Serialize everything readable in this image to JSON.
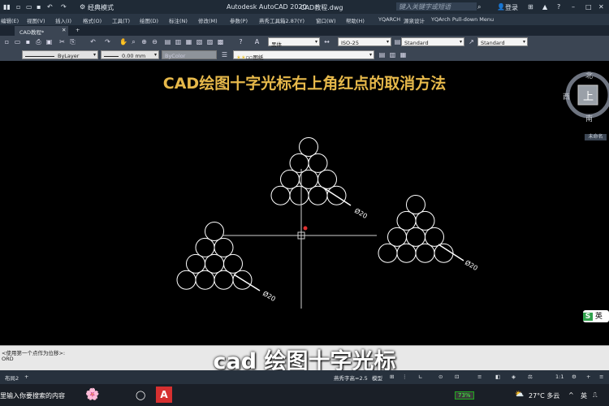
{
  "titlebar": {
    "workspace": "经典模式",
    "app_title": "Autodesk AutoCAD 2020",
    "file_title": "CAD教程.dwg",
    "search_placeholder": "键入关键字或短语",
    "login_label": "登录"
  },
  "menubar": {
    "items": [
      "编辑(E)",
      "视图(V)",
      "插入(I)",
      "格式(O)",
      "工具(T)",
      "绘图(D)",
      "标注(N)",
      "修改(M)",
      "参数(P)",
      "燕秀工具箱2.87(Y)",
      "窗口(W)",
      "帮助(H)",
      "YQARCH",
      "源泉设计",
      "YQArch Pull-down Menu"
    ]
  },
  "tabs": {
    "document": "CAD教程*",
    "add": "+"
  },
  "toolbar1": {
    "font": "黑体",
    "dimstyle": "ISO-25",
    "tablestyle": "Standard",
    "mlstyle": "Standard"
  },
  "toolbar2": {
    "linetype": "ByLayer",
    "lineweight": "0.00 mm",
    "color": "ByColor",
    "layer": "图纸"
  },
  "drawing": {
    "heading": "CAD绘图十字光标右上角红点的取消方法",
    "dim_label_1": "Ø20",
    "dim_label_2": "Ø20",
    "dim_label_3": "Ø20",
    "accent": "#e6b84a"
  },
  "viewcube": {
    "north": "北",
    "south": "南",
    "west": "西",
    "top": "上",
    "nav_label": "未命名"
  },
  "command": {
    "line1": "<使用第一个点作为位移>:",
    "line2": "ORD"
  },
  "subtitle": "cad 绘图十字光标",
  "statusbar": {
    "layout_tab": "布局2",
    "textstyle": "燕秀字高=2.5",
    "model": "模型",
    "scale": "1:1"
  },
  "taskbar": {
    "search_placeholder": "里输入你要搜索的内容",
    "battery": "73%",
    "weather": "27°C 多云",
    "ime": "英"
  },
  "ime_badge": {
    "glyph": "S",
    "label": "英"
  }
}
